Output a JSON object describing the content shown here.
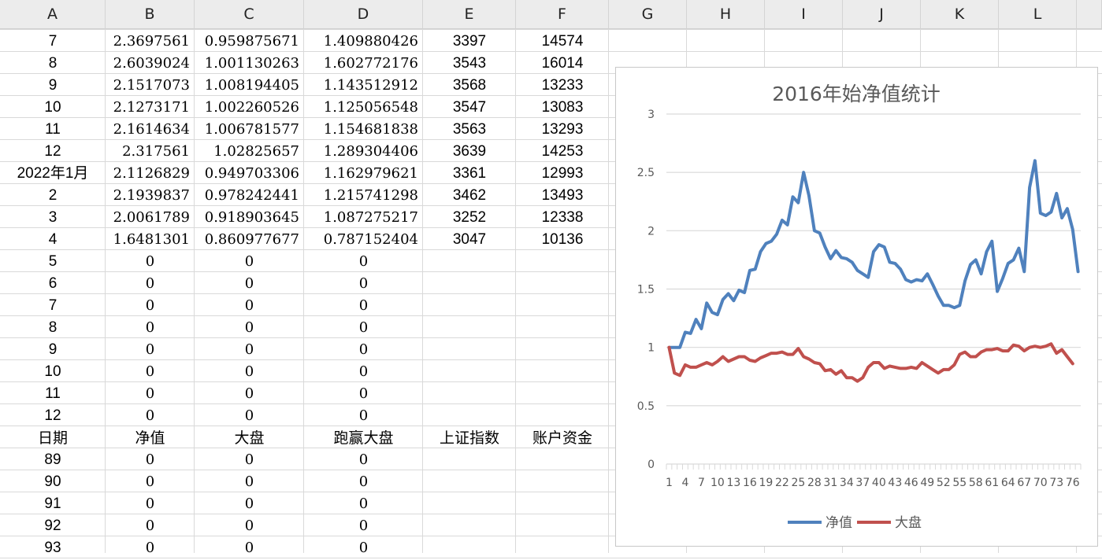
{
  "columns": [
    "A",
    "B",
    "C",
    "D",
    "E",
    "F",
    "G",
    "H",
    "I",
    "J",
    "K",
    "L"
  ],
  "rows": [
    [
      "7",
      "2.3697561",
      "0.959875671",
      "1.409880426",
      "3397",
      "14574"
    ],
    [
      "8",
      "2.6039024",
      "1.001130263",
      "1.602772176",
      "3543",
      "16014"
    ],
    [
      "9",
      "2.1517073",
      "1.008194405",
      "1.143512912",
      "3568",
      "13233"
    ],
    [
      "10",
      "2.1273171",
      "1.002260526",
      "1.125056548",
      "3547",
      "13083"
    ],
    [
      "11",
      "2.1614634",
      "1.006781577",
      "1.154681838",
      "3563",
      "13293"
    ],
    [
      "12",
      "2.317561",
      "1.02825657",
      "1.289304406",
      "3639",
      "14253"
    ],
    [
      "2022年1月",
      "2.1126829",
      "0.949703306",
      "1.162979621",
      "3361",
      "12993"
    ],
    [
      "2",
      "2.1939837",
      "0.978242441",
      "1.215741298",
      "3462",
      "13493"
    ],
    [
      "3",
      "2.0061789",
      "0.918903645",
      "1.087275217",
      "3252",
      "12338"
    ],
    [
      "4",
      "1.6481301",
      "0.860977677",
      "0.787152404",
      "3047",
      "10136"
    ],
    [
      "5",
      "0",
      "0",
      "0",
      "",
      ""
    ],
    [
      "6",
      "0",
      "0",
      "0",
      "",
      ""
    ],
    [
      "7",
      "0",
      "0",
      "0",
      "",
      ""
    ],
    [
      "8",
      "0",
      "0",
      "0",
      "",
      ""
    ],
    [
      "9",
      "0",
      "0",
      "0",
      "",
      ""
    ],
    [
      "10",
      "0",
      "0",
      "0",
      "",
      ""
    ],
    [
      "11",
      "0",
      "0",
      "0",
      "",
      ""
    ],
    [
      "12",
      "0",
      "0",
      "0",
      "",
      ""
    ],
    [
      "日期",
      "净值",
      "大盘",
      "跑赢大盘",
      "上证指数",
      "账户资金"
    ],
    [
      "89",
      "0",
      "0",
      "0",
      "",
      ""
    ],
    [
      "90",
      "0",
      "0",
      "0",
      "",
      ""
    ],
    [
      "91",
      "0",
      "0",
      "0",
      "",
      ""
    ],
    [
      "92",
      "0",
      "0",
      "0",
      "",
      ""
    ],
    [
      "93",
      "0",
      "0",
      "0",
      "",
      ""
    ]
  ],
  "chart_data": {
    "type": "line",
    "title": "2016年始净值统计",
    "ylim": [
      0,
      3
    ],
    "yticks": [
      "0",
      "0.5",
      "1",
      "1.5",
      "2",
      "2.5",
      "3"
    ],
    "xticklabels": [
      "1",
      "4",
      "7",
      "10",
      "13",
      "16",
      "19",
      "22",
      "25",
      "28",
      "31",
      "34",
      "37",
      "40",
      "43",
      "46",
      "49",
      "52",
      "55",
      "58",
      "61",
      "64",
      "67",
      "70",
      "73",
      "76"
    ],
    "legend_position": "bottom",
    "grid": true,
    "series": [
      {
        "name": "净值",
        "color": "#4f81bd",
        "values": [
          1.0,
          1.0,
          1.0,
          1.13,
          1.12,
          1.24,
          1.16,
          1.38,
          1.3,
          1.28,
          1.41,
          1.46,
          1.4,
          1.49,
          1.47,
          1.66,
          1.67,
          1.82,
          1.89,
          1.91,
          1.97,
          2.09,
          2.05,
          2.29,
          2.24,
          2.5,
          2.3,
          2.0,
          1.98,
          1.86,
          1.76,
          1.83,
          1.77,
          1.76,
          1.73,
          1.66,
          1.63,
          1.6,
          1.82,
          1.88,
          1.86,
          1.73,
          1.72,
          1.67,
          1.58,
          1.56,
          1.58,
          1.57,
          1.63,
          1.54,
          1.44,
          1.36,
          1.36,
          1.34,
          1.36,
          1.57,
          1.71,
          1.75,
          1.63,
          1.82,
          1.91,
          1.48,
          1.59,
          1.72,
          1.75,
          1.85,
          1.65,
          2.37,
          2.6,
          2.15,
          2.13,
          2.16,
          2.32,
          2.11,
          2.19,
          2.01,
          1.65
        ]
      },
      {
        "name": "大盘",
        "color": "#c0504d",
        "values": [
          1.0,
          0.78,
          0.76,
          0.85,
          0.83,
          0.83,
          0.85,
          0.87,
          0.85,
          0.88,
          0.92,
          0.88,
          0.9,
          0.92,
          0.92,
          0.89,
          0.88,
          0.91,
          0.93,
          0.95,
          0.95,
          0.96,
          0.94,
          0.94,
          0.99,
          0.92,
          0.9,
          0.87,
          0.86,
          0.8,
          0.81,
          0.77,
          0.8,
          0.74,
          0.74,
          0.71,
          0.74,
          0.83,
          0.87,
          0.87,
          0.82,
          0.84,
          0.83,
          0.82,
          0.82,
          0.83,
          0.82,
          0.87,
          0.84,
          0.81,
          0.78,
          0.81,
          0.81,
          0.85,
          0.94,
          0.96,
          0.92,
          0.92,
          0.96,
          0.98,
          0.98,
          0.99,
          0.97,
          0.97,
          1.02,
          1.01,
          0.97,
          1.0,
          1.01,
          1.0,
          1.01,
          1.03,
          0.95,
          0.98,
          0.92,
          0.86
        ]
      }
    ]
  }
}
